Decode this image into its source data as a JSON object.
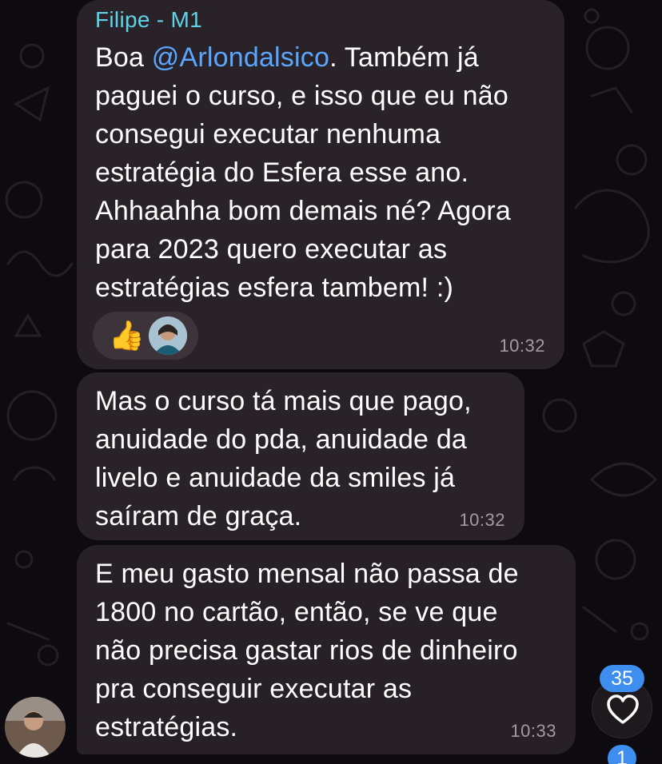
{
  "messages": [
    {
      "sender": "Filipe - M1",
      "text_before_mention": "Boa ",
      "mention": "@Arlondalsico",
      "text_after_mention": ". Também já\npaguei o curso, e isso que eu não\nconsegui executar nenhuma\nestratégia do Esfera esse ano.\nAhhaahha bom demais né? Agora\npara 2023 quero executar as\nestratégias esfera tambem! :)",
      "time": "10:32",
      "reactions": {
        "emoji": "👍",
        "reactor_avatar": "reactor-avatar"
      }
    },
    {
      "text": "Mas o curso tá mais que pago,\nanuidade do pda, anuidade da\nlivelo e anuidade da smiles já\nsaíram de graça.",
      "time": "10:32"
    },
    {
      "text": "E meu gasto mensal não passa de\n1800 no cartão, então, se ve que\nnão precisa gastar rios de dinheiro\npra conseguir executar as\nestratégias.",
      "time": "10:33"
    }
  ],
  "scroll_to_reactions": {
    "count": "35",
    "icon": "heart-icon"
  },
  "bottom_badge": "1",
  "colors": {
    "background": "#0d0a10",
    "bubble": "#2a2229",
    "sender_name": "#5fd3e6",
    "mention": "#5aa7ff",
    "time": "#a39ba3",
    "badge": "#3e8ef0"
  }
}
